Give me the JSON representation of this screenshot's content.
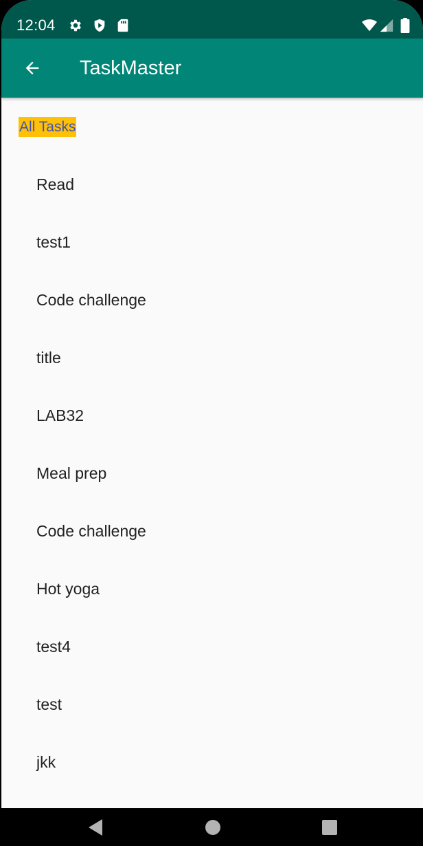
{
  "status_bar": {
    "time": "12:04",
    "left_icons": [
      "gear-icon",
      "shield-icon",
      "sd-card-icon"
    ],
    "right_icons": [
      "wifi-icon",
      "signal-icon",
      "battery-icon"
    ]
  },
  "app_bar": {
    "back_icon": "arrow-left-icon",
    "title": "TaskMaster"
  },
  "list": {
    "header": "All Tasks",
    "items": [
      "Read",
      "test1",
      "Code challenge",
      "title",
      "LAB32",
      "Meal prep",
      "Code challenge",
      "Hot yoga",
      "test4",
      "test",
      "jkk"
    ]
  },
  "nav_bar": {
    "buttons": [
      "back-triangle-icon",
      "home-circle-icon",
      "recents-square-icon"
    ]
  },
  "colors": {
    "status_bar": "#00574b",
    "app_bar": "#008577",
    "header_highlight": "#ffc107",
    "header_text": "#3f51b5",
    "item_text": "#212121",
    "background": "#fafafa"
  }
}
